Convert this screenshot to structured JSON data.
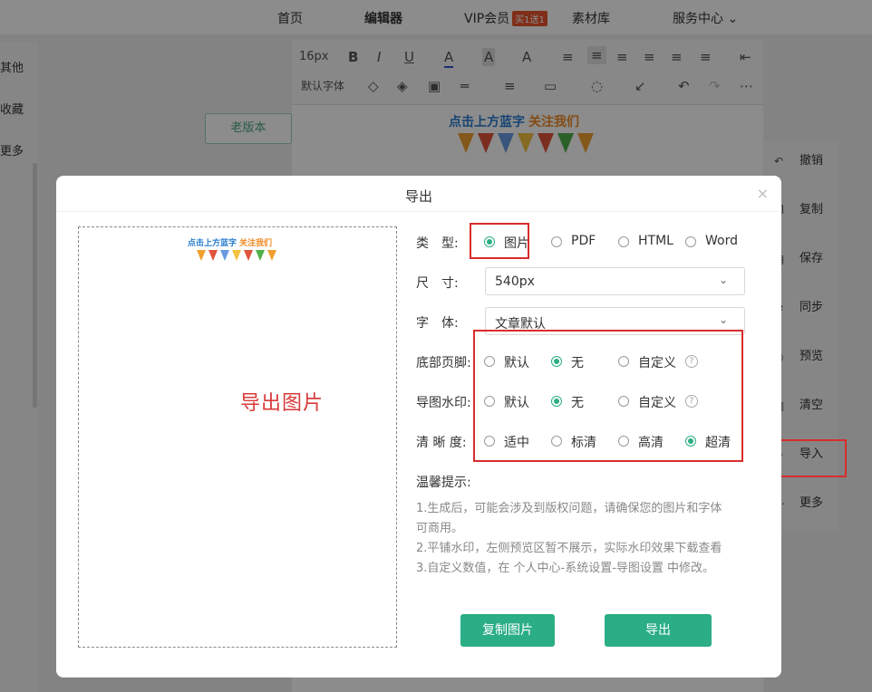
{
  "nav": {
    "items": [
      "首页",
      "编辑器",
      "VIP会员",
      "素材库",
      "服务中心"
    ],
    "vip_badge": "买1送1",
    "dropdown_caret": "⌄"
  },
  "left_panel": {
    "items": [
      "其他",
      "收藏",
      "更多"
    ]
  },
  "toolbar": {
    "font_size": "16px",
    "font_family": "默认字体"
  },
  "editor": {
    "old_version_button": "老版本",
    "banner_blue": "点击上方蓝字",
    "banner_orange": "关注我们"
  },
  "right_panel": {
    "items": [
      "撤销",
      "复制",
      "保存",
      "同步",
      "预览",
      "清空",
      "导入",
      "更多"
    ]
  },
  "modal": {
    "title": "导出",
    "close": "×",
    "preview": {
      "banner_blue": "点击上方蓝字",
      "banner_orange": "关注我们",
      "text": "导出图片"
    },
    "type": {
      "label": "类　型:",
      "options": [
        "图片",
        "PDF",
        "HTML",
        "Word"
      ],
      "selected": "图片"
    },
    "size": {
      "label": "尺　寸:",
      "value": "540px"
    },
    "font": {
      "label": "字　体:",
      "value": "文章默认"
    },
    "footer": {
      "label": "底部页脚:",
      "options": [
        "默认",
        "无",
        "自定义"
      ],
      "selected": "无"
    },
    "watermark": {
      "label": "导图水印:",
      "options": [
        "默认",
        "无",
        "自定义"
      ],
      "selected": "无"
    },
    "clarity": {
      "label": "清 晰 度:",
      "options": [
        "适中",
        "标清",
        "高清",
        "超清"
      ],
      "selected": "超清"
    },
    "help_glyph": "?",
    "tips_title": "温馨提示:",
    "tips": [
      "1.生成后，可能会涉及到版权问题，请确保您的图片和字体",
      "可商用。",
      "2.平铺水印，左侧预览区暂不展示，实际水印效果下载查看",
      "3.自定义数值，在 个人中心-系统设置-导图设置 中修改。"
    ],
    "copy_button": "复制图片",
    "export_button": "导出"
  },
  "colors": {
    "accent": "#2bae85",
    "highlight": "#d92c2c",
    "vip_badge": "#e8542c"
  }
}
